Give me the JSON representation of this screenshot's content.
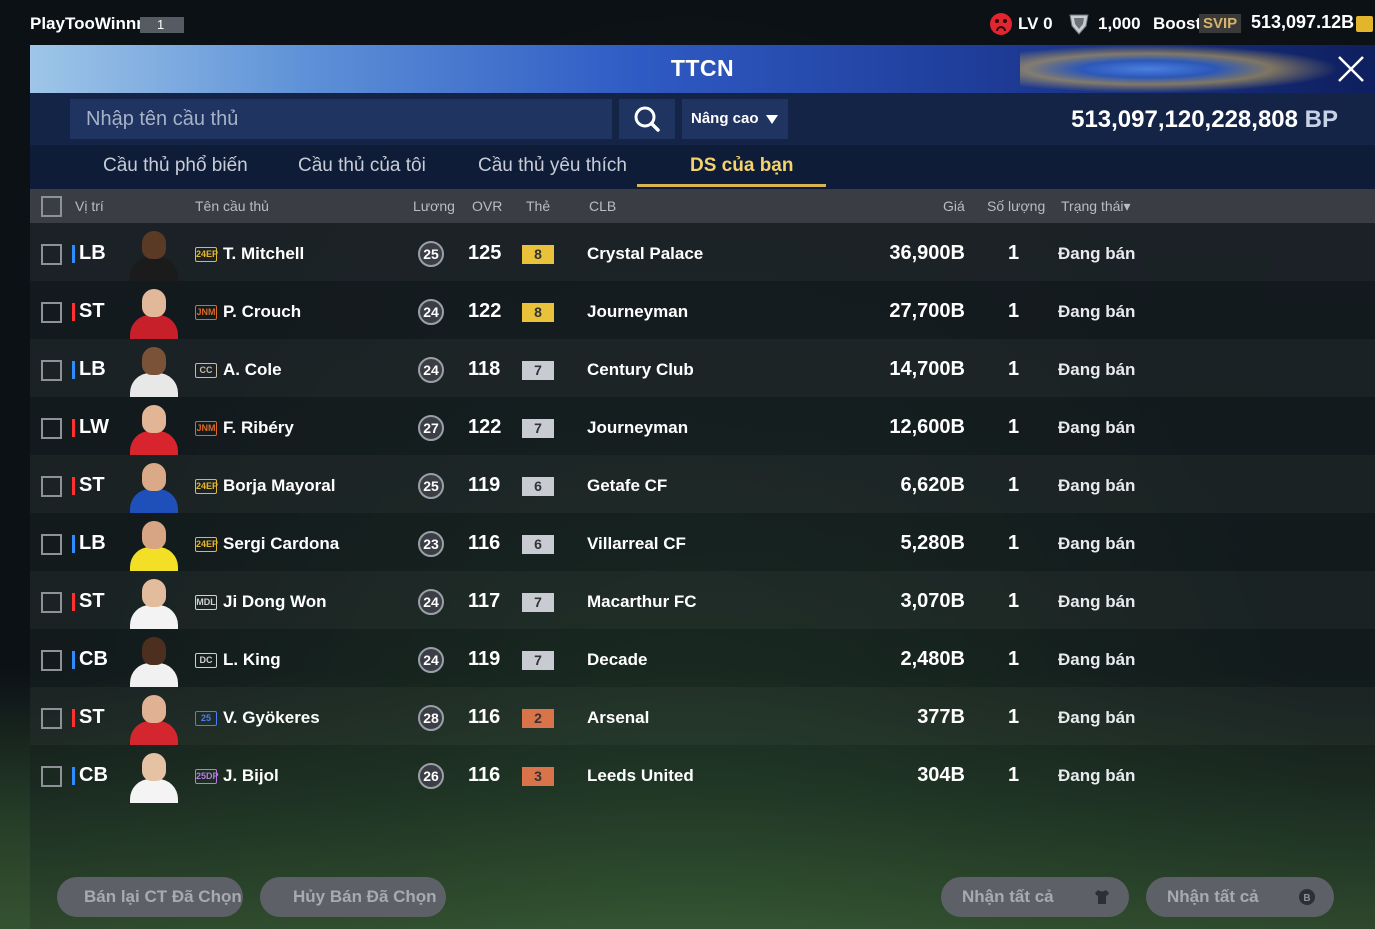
{
  "header": {
    "username": "PlayTooWinnn",
    "user_level": "1",
    "lv_label": "LV 0",
    "coins": "1,000",
    "boost_label": "Boost",
    "svip_label": "SVIP",
    "bp_short": "513,097.12B"
  },
  "banner": {
    "title": "TTCN"
  },
  "search": {
    "placeholder": "Nhập tên cầu thủ",
    "advanced_label": "Nâng cao",
    "bp_total": "513,097,120,228,808",
    "bp_unit": "BP"
  },
  "tabs": [
    {
      "label": "Cầu thủ phổ biến"
    },
    {
      "label": "Cầu thủ của tôi"
    },
    {
      "label": "Cầu thủ yêu thích"
    },
    {
      "label": "DS của bạn",
      "active": true
    }
  ],
  "table": {
    "headers": {
      "position": "Vị trí",
      "name": "Tên cầu thủ",
      "salary": "Lương",
      "ovr": "OVR",
      "card": "Thẻ",
      "club": "CLB",
      "price": "Giá",
      "quantity": "Số lượng",
      "status": "Trạng thái▾"
    },
    "rows": [
      {
        "pos": "LB",
        "pos_color": "#2f8cff",
        "season": "24EP",
        "season_color": "#e6b82e",
        "name": "T. Mitchell",
        "salary": "25",
        "ovr": "125",
        "card": "8",
        "card_color": "#e9c23a",
        "club": "Crystal Palace",
        "price": "36,900B",
        "qty": "1",
        "status": "Đang bán",
        "skin": "#5a3a24",
        "kit": "#1b1b1b"
      },
      {
        "pos": "ST",
        "pos_color": "#ff3030",
        "season": "JNM",
        "season_color": "#d86a2a",
        "name": "P. Crouch",
        "salary": "24",
        "ovr": "122",
        "card": "8",
        "card_color": "#e9c23a",
        "club": "Journeyman",
        "price": "27,700B",
        "qty": "1",
        "status": "Đang bán",
        "skin": "#e1b99a",
        "kit": "#c8202a"
      },
      {
        "pos": "LB",
        "pos_color": "#2f8cff",
        "season": "CC",
        "season_color": "#c9b8a2",
        "name": "A. Cole",
        "salary": "24",
        "ovr": "118",
        "card": "7",
        "card_color": "#c8ccd2",
        "club": "Century Club",
        "price": "14,700B",
        "qty": "1",
        "status": "Đang bán",
        "skin": "#7a5238",
        "kit": "#e8e8e8"
      },
      {
        "pos": "LW",
        "pos_color": "#ff3030",
        "season": "JNM",
        "season_color": "#d86a2a",
        "name": "F. Ribéry",
        "salary": "27",
        "ovr": "122",
        "card": "7",
        "card_color": "#c8ccd2",
        "club": "Journeyman",
        "price": "12,600B",
        "qty": "1",
        "status": "Đang bán",
        "skin": "#e3b597",
        "kit": "#d8242c"
      },
      {
        "pos": "ST",
        "pos_color": "#ff3030",
        "season": "24EP",
        "season_color": "#e6b82e",
        "name": "Borja Mayoral",
        "salary": "25",
        "ovr": "119",
        "card": "6",
        "card_color": "#c8ccd2",
        "club": "Getafe CF",
        "price": "6,620B",
        "qty": "1",
        "status": "Đang bán",
        "skin": "#d9a988",
        "kit": "#1f4fb8"
      },
      {
        "pos": "LB",
        "pos_color": "#2f8cff",
        "season": "24EP",
        "season_color": "#e6b82e",
        "name": "Sergi Cardona",
        "salary": "23",
        "ovr": "116",
        "card": "6",
        "card_color": "#c8ccd2",
        "club": "Villarreal CF",
        "price": "5,280B",
        "qty": "1",
        "status": "Đang bán",
        "skin": "#d8a584",
        "kit": "#f2df26"
      },
      {
        "pos": "ST",
        "pos_color": "#ff3030",
        "season": "MDL",
        "season_color": "#d0d0d0",
        "name": "Ji Dong Won",
        "salary": "24",
        "ovr": "117",
        "card": "7",
        "card_color": "#c8ccd2",
        "club": "Macarthur FC",
        "price": "3,070B",
        "qty": "1",
        "status": "Đang bán",
        "skin": "#e2bc9c",
        "kit": "#f3f3f3"
      },
      {
        "pos": "CB",
        "pos_color": "#2f8cff",
        "season": "DC",
        "season_color": "#cfcfcf",
        "name": "L. King",
        "salary": "24",
        "ovr": "119",
        "card": "7",
        "card_color": "#c8ccd2",
        "club": "Decade",
        "price": "2,480B",
        "qty": "1",
        "status": "Đang bán",
        "skin": "#4c2f1e",
        "kit": "#f1f1f1"
      },
      {
        "pos": "ST",
        "pos_color": "#ff3030",
        "season": "25",
        "season_color": "#4a7cff",
        "name": "V. Gyökeres",
        "salary": "28",
        "ovr": "116",
        "card": "2",
        "card_color": "#d8734a",
        "club": "Arsenal",
        "price": "377B",
        "qty": "1",
        "status": "Đang bán",
        "skin": "#e0b193",
        "kit": "#d3262e"
      },
      {
        "pos": "CB",
        "pos_color": "#2f8cff",
        "season": "25DP",
        "season_color": "#b77ae0",
        "name": "J. Bijol",
        "salary": "26",
        "ovr": "116",
        "card": "3",
        "card_color": "#d8734a",
        "club": "Leeds United",
        "price": "304B",
        "qty": "1",
        "status": "Đang bán",
        "skin": "#e6c2a4",
        "kit": "#f4f4f4"
      }
    ]
  },
  "footer": {
    "resell_label": "Bán lại CT Đã Chọn",
    "cancel_label": "Hủy Bán Đã Chọn",
    "claim_all_1": "Nhận tất cả",
    "claim_all_2": "Nhận tất cả"
  }
}
